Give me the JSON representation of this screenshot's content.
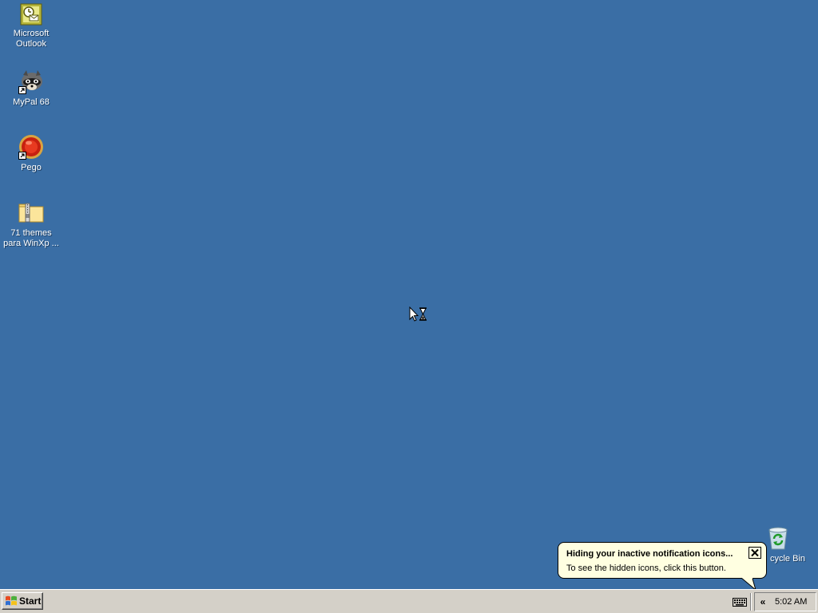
{
  "desktop": {
    "background_color": "#3a6ea5",
    "icons": [
      {
        "label": "Microsoft\nOutlook",
        "icon": "outlook-icon"
      },
      {
        "label": "MyPal 68",
        "icon": "mypal-icon"
      },
      {
        "label": "Pego",
        "icon": "pego-icon"
      },
      {
        "label": "71 themes\npara WinXp ...",
        "icon": "zip-folder-icon"
      },
      {
        "label": "cycle Bin",
        "icon": "recycle-bin-icon"
      }
    ]
  },
  "taskbar": {
    "start_label": "Start",
    "tray_expand_label": "«",
    "clock": "5:02 AM"
  },
  "balloon": {
    "title": "Hiding your inactive notification icons...",
    "body": "To see the hidden icons, click this button."
  }
}
